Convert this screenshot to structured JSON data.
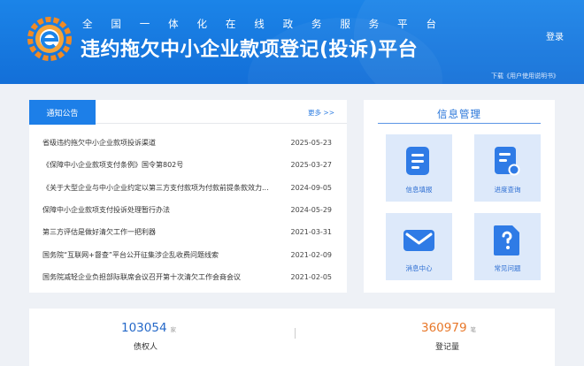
{
  "header": {
    "subtitle": [
      "全",
      "国",
      "一",
      "体",
      "化",
      "在",
      "线",
      "政",
      "务",
      "服",
      "务",
      "平",
      "台"
    ],
    "title": "违约拖欠中小企业款项登记(投诉)平台",
    "login_label": "登录",
    "download_text": "下载《用户使用说明书》",
    "colors": {
      "primary": "#1b84e8",
      "logo_orange": "#f08a24"
    }
  },
  "notice": {
    "tab_label": "通知公告",
    "more_label": "更多 >>",
    "items": [
      {
        "title": "省级违约拖欠中小企业款项投诉渠道",
        "date": "2025-05-23"
      },
      {
        "title": "《保障中小企业款项支付条例》国令第802号",
        "date": "2025-03-27"
      },
      {
        "title": "《关于大型企业与中小企业约定以第三方支付款项为付款前提条款效力...",
        "date": "2024-09-05"
      },
      {
        "title": "保障中小企业款项支付投诉处理暂行办法",
        "date": "2024-05-29"
      },
      {
        "title": "第三方评估是做好清欠工作一把利器",
        "date": "2021-03-31"
      },
      {
        "title": "国务院“互联网+督查”平台公开征集涉企乱收费问题线索",
        "date": "2021-02-09"
      },
      {
        "title": "国务院减轻企业负担部际联席会议召开第十次清欠工作会商会议",
        "date": "2021-02-05"
      }
    ]
  },
  "info": {
    "title": "信息管理",
    "tiles": [
      {
        "label": "信息填报",
        "icon": "form-fill-icon"
      },
      {
        "label": "进度查询",
        "icon": "progress-query-icon"
      },
      {
        "label": "消息中心",
        "icon": "mail-icon"
      },
      {
        "label": "常见问题",
        "icon": "faq-document-icon"
      }
    ]
  },
  "stats": {
    "creditor": {
      "value": "103054",
      "unit": "家",
      "label": "债权人",
      "color": "#2468c8"
    },
    "registration": {
      "value": "360979",
      "unit": "笔",
      "label": "登记量",
      "color": "#e8782a"
    }
  }
}
